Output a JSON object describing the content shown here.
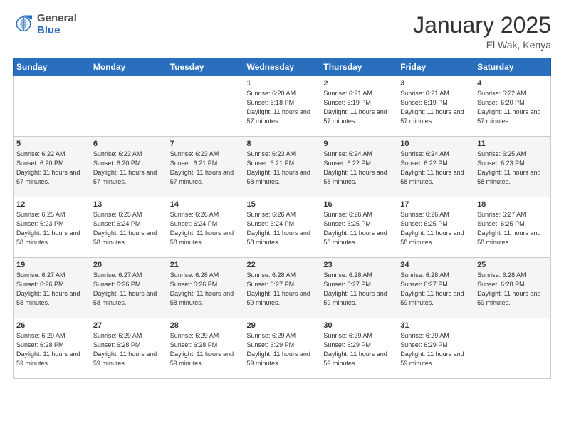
{
  "header": {
    "logo": {
      "general": "General",
      "blue": "Blue"
    },
    "title": "January 2025",
    "location": "El Wak, Kenya"
  },
  "days_of_week": [
    "Sunday",
    "Monday",
    "Tuesday",
    "Wednesday",
    "Thursday",
    "Friday",
    "Saturday"
  ],
  "weeks": [
    [
      {
        "day": "",
        "sunrise": "",
        "sunset": "",
        "daylight": "",
        "empty": true
      },
      {
        "day": "",
        "sunrise": "",
        "sunset": "",
        "daylight": "",
        "empty": true
      },
      {
        "day": "",
        "sunrise": "",
        "sunset": "",
        "daylight": "",
        "empty": true
      },
      {
        "day": "1",
        "sunrise": "6:20 AM",
        "sunset": "6:18 PM",
        "daylight": "11 hours and 57 minutes."
      },
      {
        "day": "2",
        "sunrise": "6:21 AM",
        "sunset": "6:19 PM",
        "daylight": "11 hours and 57 minutes."
      },
      {
        "day": "3",
        "sunrise": "6:21 AM",
        "sunset": "6:19 PM",
        "daylight": "11 hours and 57 minutes."
      },
      {
        "day": "4",
        "sunrise": "6:22 AM",
        "sunset": "6:20 PM",
        "daylight": "11 hours and 57 minutes."
      }
    ],
    [
      {
        "day": "5",
        "sunrise": "6:22 AM",
        "sunset": "6:20 PM",
        "daylight": "11 hours and 57 minutes."
      },
      {
        "day": "6",
        "sunrise": "6:23 AM",
        "sunset": "6:20 PM",
        "daylight": "11 hours and 57 minutes."
      },
      {
        "day": "7",
        "sunrise": "6:23 AM",
        "sunset": "6:21 PM",
        "daylight": "11 hours and 57 minutes."
      },
      {
        "day": "8",
        "sunrise": "6:23 AM",
        "sunset": "6:21 PM",
        "daylight": "11 hours and 58 minutes."
      },
      {
        "day": "9",
        "sunrise": "6:24 AM",
        "sunset": "6:22 PM",
        "daylight": "11 hours and 58 minutes."
      },
      {
        "day": "10",
        "sunrise": "6:24 AM",
        "sunset": "6:22 PM",
        "daylight": "11 hours and 58 minutes."
      },
      {
        "day": "11",
        "sunrise": "6:25 AM",
        "sunset": "6:23 PM",
        "daylight": "11 hours and 58 minutes."
      }
    ],
    [
      {
        "day": "12",
        "sunrise": "6:25 AM",
        "sunset": "6:23 PM",
        "daylight": "11 hours and 58 minutes."
      },
      {
        "day": "13",
        "sunrise": "6:25 AM",
        "sunset": "6:24 PM",
        "daylight": "11 hours and 58 minutes."
      },
      {
        "day": "14",
        "sunrise": "6:26 AM",
        "sunset": "6:24 PM",
        "daylight": "11 hours and 58 minutes."
      },
      {
        "day": "15",
        "sunrise": "6:26 AM",
        "sunset": "6:24 PM",
        "daylight": "11 hours and 58 minutes."
      },
      {
        "day": "16",
        "sunrise": "6:26 AM",
        "sunset": "6:25 PM",
        "daylight": "11 hours and 58 minutes."
      },
      {
        "day": "17",
        "sunrise": "6:26 AM",
        "sunset": "6:25 PM",
        "daylight": "11 hours and 58 minutes."
      },
      {
        "day": "18",
        "sunrise": "6:27 AM",
        "sunset": "6:25 PM",
        "daylight": "11 hours and 58 minutes."
      }
    ],
    [
      {
        "day": "19",
        "sunrise": "6:27 AM",
        "sunset": "6:26 PM",
        "daylight": "11 hours and 58 minutes."
      },
      {
        "day": "20",
        "sunrise": "6:27 AM",
        "sunset": "6:26 PM",
        "daylight": "11 hours and 58 minutes."
      },
      {
        "day": "21",
        "sunrise": "6:28 AM",
        "sunset": "6:26 PM",
        "daylight": "11 hours and 58 minutes."
      },
      {
        "day": "22",
        "sunrise": "6:28 AM",
        "sunset": "6:27 PM",
        "daylight": "11 hours and 59 minutes."
      },
      {
        "day": "23",
        "sunrise": "6:28 AM",
        "sunset": "6:27 PM",
        "daylight": "11 hours and 59 minutes."
      },
      {
        "day": "24",
        "sunrise": "6:28 AM",
        "sunset": "6:27 PM",
        "daylight": "11 hours and 59 minutes."
      },
      {
        "day": "25",
        "sunrise": "6:28 AM",
        "sunset": "6:28 PM",
        "daylight": "11 hours and 59 minutes."
      }
    ],
    [
      {
        "day": "26",
        "sunrise": "6:29 AM",
        "sunset": "6:28 PM",
        "daylight": "11 hours and 59 minutes."
      },
      {
        "day": "27",
        "sunrise": "6:29 AM",
        "sunset": "6:28 PM",
        "daylight": "11 hours and 59 minutes."
      },
      {
        "day": "28",
        "sunrise": "6:29 AM",
        "sunset": "6:28 PM",
        "daylight": "11 hours and 59 minutes."
      },
      {
        "day": "29",
        "sunrise": "6:29 AM",
        "sunset": "6:29 PM",
        "daylight": "11 hours and 59 minutes."
      },
      {
        "day": "30",
        "sunrise": "6:29 AM",
        "sunset": "6:29 PM",
        "daylight": "11 hours and 59 minutes."
      },
      {
        "day": "31",
        "sunrise": "6:29 AM",
        "sunset": "6:29 PM",
        "daylight": "11 hours and 59 minutes."
      },
      {
        "day": "",
        "sunrise": "",
        "sunset": "",
        "daylight": "",
        "empty": true
      }
    ]
  ],
  "labels": {
    "sunrise": "Sunrise:",
    "sunset": "Sunset:",
    "daylight": "Daylight:"
  },
  "colors": {
    "header_bg": "#2a6fbd",
    "accent": "#2a6fbd"
  }
}
